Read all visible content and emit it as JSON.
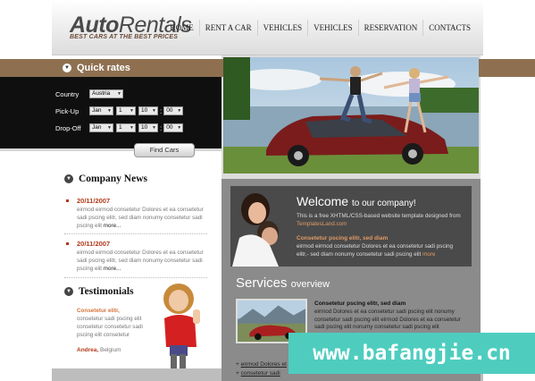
{
  "header": {
    "logo_bold": "Auto",
    "logo_light": "Rentals",
    "tagline": "BEST CARS AT THE BEST PRICES",
    "nav": [
      "HOME",
      "RENT A CAR",
      "VEHICLES",
      "VEHICLES",
      "RESERVATION",
      "CONTACTS"
    ]
  },
  "quick_rates": {
    "title": "Quick rates",
    "country_label": "Country",
    "country_value": "Austria",
    "pickup_label": "Pick-Up",
    "dropoff_label": "Drop-Off",
    "month_value": "Jan",
    "day_value": "1",
    "hour_value": "10",
    "minute_value": "00",
    "find_button": "Find Cars"
  },
  "company_news": {
    "title": "Company News",
    "items": [
      {
        "date": "20/11/2007",
        "text": "eirmod eirmod consetetur Dolores et ea consetetur sadi pscing elitr, sed diam nonumy consetetur sadi pscing elit",
        "more": "more..."
      },
      {
        "date": "20/11/2007",
        "text": "eirmod eirmod consetetur Dolores et ea consetetur sadi pscing elitr, sed diam nonumy consetetur sadi pscing elit",
        "more": "more..."
      }
    ]
  },
  "testimonials": {
    "title": "Testimonials",
    "heading": "Consetetur elitr,",
    "text": "consetetur sadi pscing elit consetetur consetetur sadi pscing elit consetetur",
    "author": "Andrea,",
    "location": "Belgium"
  },
  "welcome": {
    "title": "Welcome",
    "title_small": "to our company!",
    "text": "This is a free XHTML/CSS-based website template designed from",
    "link": "TemplatesLand.com",
    "subhead": "Consetetur pscing elitr, sed diam",
    "text2": "eirmod eirmod consetetur Dolores et ea consetetur sadi pscing elitr,- sed diam nonumy consetetur sadi pscing elit",
    "more": "more"
  },
  "services": {
    "title": "Services",
    "title_small": "overview",
    "subhead": "Consetetur pscing elitr, sed diam",
    "text": "eirmod Dolores et ea consetetur sadi pscing elit nonumy consetetur sadi pscing elit eirmod Dolores et ea consetetur sadi pscing elit nonumy consetetur sadi pscing elit",
    "links": [
      "eirmod Dolores et",
      "consetetur sadi"
    ]
  },
  "watermark": "www.bafangjie.cn"
}
